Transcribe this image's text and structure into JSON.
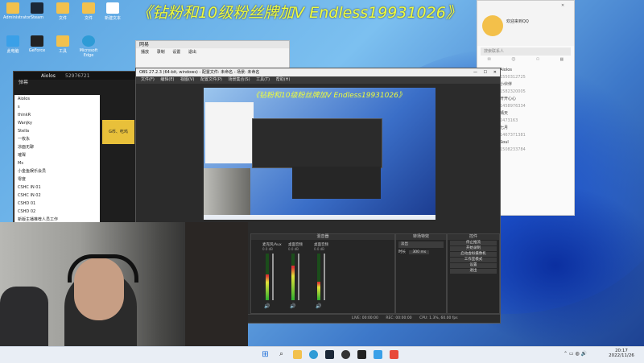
{
  "banner": {
    "text": "《钻粉和10级粉丝牌加V Endless19931026》"
  },
  "desktop": {
    "icons": [
      {
        "label": "Administrator",
        "color": "#f2c14e"
      },
      {
        "label": "Steam",
        "color": "#1b2838"
      },
      {
        "label": "文件",
        "color": "#f2c14e"
      },
      {
        "label": "文件",
        "color": "#f2c14e"
      },
      {
        "label": "新建文本",
        "color": "#ffffff"
      },
      {
        "label": "此电脑",
        "color": "#3aa0e8"
      },
      {
        "label": "GeForce",
        "color": "#76b900"
      },
      {
        "label": "工具",
        "color": "#f2c14e"
      },
      {
        "label": "Microsoft Edge",
        "color": "#2e9bd6"
      }
    ]
  },
  "small_window": {
    "title": "网易",
    "menu": [
      "播放",
      "录制",
      "设置",
      "退出"
    ]
  },
  "obs": {
    "title": "OBS 27.2.3 (64-bit, windows) - 配置文件: 未命名 - 场景: 未命名",
    "menu": [
      "文件(F)",
      "编辑(E)",
      "视图(V)",
      "配置文件(P)",
      "场景集合(S)",
      "工具(T)",
      "帮助(H)"
    ],
    "preview_banner": "《钻粉和10级粉丝牌加V Endless19931026》",
    "mixer_title": "混音器",
    "channels": [
      {
        "name": "麦克风/Aux",
        "db": "0.0 dB",
        "level": 0.55
      },
      {
        "name": "桌面音频",
        "db": "0.0 dB",
        "level": 0.75
      },
      {
        "name": "桌面音频",
        "db": "0.0 dB",
        "level": 0.4
      }
    ],
    "transition_title": "转场特效",
    "transition_type": "淡出",
    "duration_label": "时长",
    "duration_value": "300 ms",
    "controls_title": "控件",
    "controls": [
      "停止推流",
      "开始录制",
      "启动虚拟摄像机",
      "工作室模式",
      "设置",
      "退出"
    ],
    "status": {
      "live": "LIVE: 00:00:00",
      "rec": "REC: 00:00:00",
      "cpu": "CPU: 1.3%, 60.00 fps"
    }
  },
  "chat": {
    "user": "Aiolos",
    "room_id": "52976721",
    "header": "弹幕",
    "list": [
      "Aiolos",
      "s",
      "thinkR",
      "Wanjky",
      "Stella",
      "一枚永",
      "凉面无聊",
      "璀璨",
      "Ms",
      "小金鱼娱乐会员",
      "零度",
      "CSHC IN 01",
      "CSHC IN 02",
      "CSHD 01",
      "CSHD 02",
      "新版主播推荐人员工作"
    ],
    "stream_tags": [
      "G币、吃鸡"
    ]
  },
  "qq": {
    "greeting": "欢迎来到QQ",
    "search_placeholder": "搜索联系人",
    "contacts": [
      {
        "name": "Aiolos",
        "sub": "1550312725"
      },
      {
        "name": "小伙伴",
        "sub": "1582320005"
      },
      {
        "name": "开开心心",
        "sub": "1458976334"
      },
      {
        "name": "晴天",
        "sub": "2473163"
      },
      {
        "name": "七月",
        "sub": "1467371381"
      },
      {
        "name": "Soul",
        "sub": "1508233784"
      }
    ]
  },
  "taskbar": {
    "time": "20:17",
    "date": "2022/11/26"
  }
}
